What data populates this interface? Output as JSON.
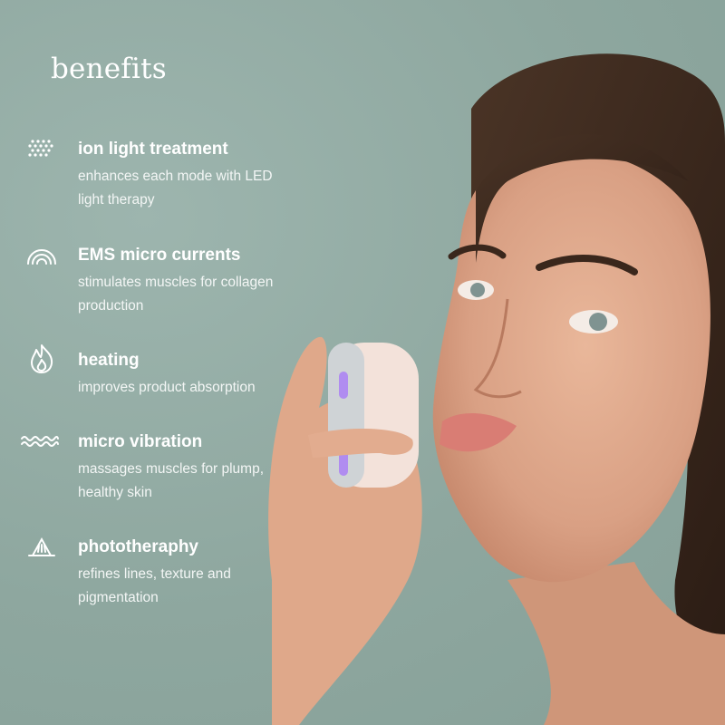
{
  "title": "benefits",
  "benefits": [
    {
      "icon": "dots-light-icon",
      "name": "ion light treatment",
      "description": "enhances each mode with LED light therapy"
    },
    {
      "icon": "rainbow-arcs-icon",
      "name": "EMS micro currents",
      "description": "stimulates muscles for collagen production"
    },
    {
      "icon": "flame-icon",
      "name": "heating",
      "description": "improves product absorption"
    },
    {
      "icon": "wave-lines-icon",
      "name": "micro vibration",
      "description": "massages muscles for plump, healthy skin"
    },
    {
      "icon": "light-rays-icon",
      "name": "phototheraphy",
      "description": "refines lines, texture and pigmentation"
    }
  ],
  "colors": {
    "background": "#8fa9a2",
    "text": "#ffffff"
  }
}
